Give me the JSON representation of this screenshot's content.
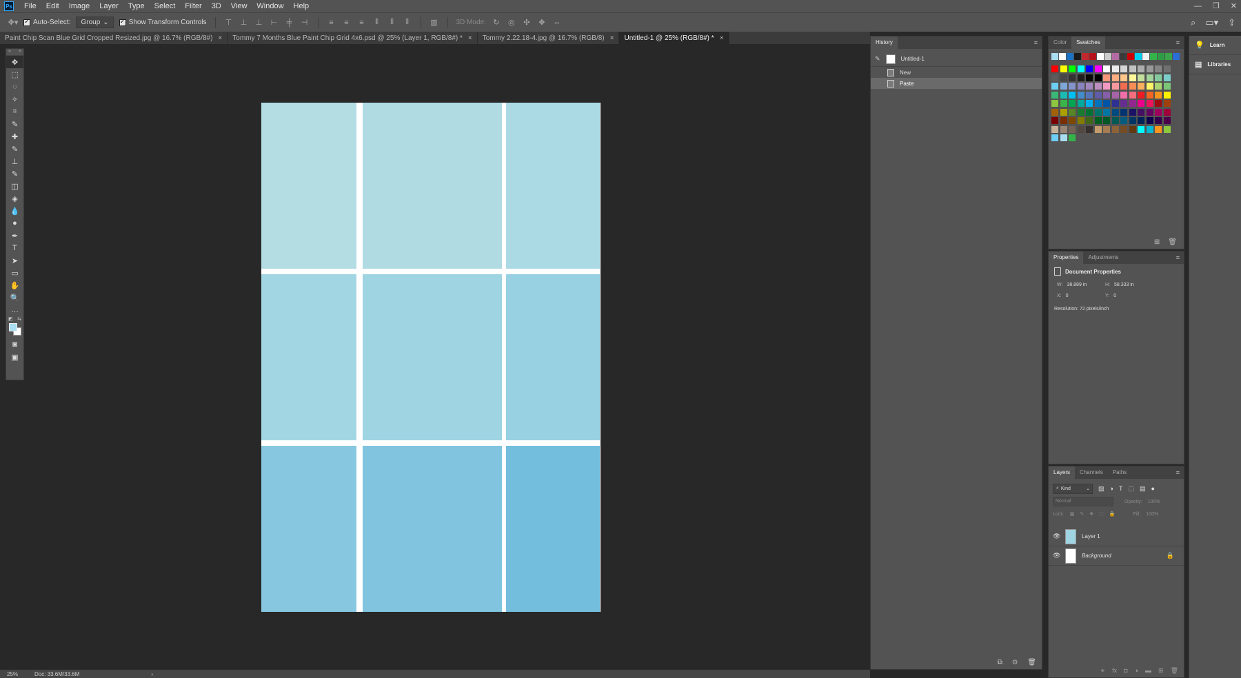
{
  "app": {
    "logo": "Ps",
    "menu": [
      "File",
      "Edit",
      "Image",
      "Layer",
      "Type",
      "Select",
      "Filter",
      "3D",
      "View",
      "Window",
      "Help"
    ],
    "window_controls": [
      "—",
      "❐",
      "✕"
    ]
  },
  "options_bar": {
    "auto_select_label": "Auto-Select:",
    "auto_select_value": "Group",
    "show_transform_label": "Show Transform Controls",
    "mode_3d_label": "3D Mode:"
  },
  "tabs": [
    {
      "label": "Paint Chip Scan Blue Grid Cropped Resized.jpg @ 16.7% (RGB/8#)",
      "active": false
    },
    {
      "label": "Tommy 7 Months Blue Paint Chip Grid 4x6.psd @ 25% (Layer 1, RGB/8#) *",
      "active": false
    },
    {
      "label": "Tommy 2.22.18-4.jpg @ 16.7% (RGB/8)",
      "active": false
    },
    {
      "label": "Untitled-1 @ 25% (RGB/8#) *",
      "active": true
    }
  ],
  "tools": [
    "move-icon",
    "marquee-icon",
    "lasso-icon",
    "magic-wand-icon",
    "crop-icon",
    "eyedropper-icon",
    "healing-brush-icon",
    "brush-icon",
    "clone-stamp-icon",
    "history-brush-icon",
    "eraser-icon",
    "paint-bucket-icon",
    "blur-icon",
    "dodge-icon",
    "pen-icon",
    "type-icon",
    "path-select-icon",
    "rectangle-icon",
    "hand-icon",
    "zoom-icon",
    "more-icon"
  ],
  "tool_glyphs": [
    "✥",
    "⬚",
    "◌",
    "✧",
    "⌗",
    "✎",
    "✚",
    "✎",
    "⊥",
    "✎",
    "◫",
    "◈",
    "💧",
    "●",
    "✒",
    "T",
    "➤",
    "▭",
    "✋",
    "🔍",
    "…"
  ],
  "colors": {
    "foreground": "#a9def0",
    "background": "#ffffff"
  },
  "document": {
    "chip_colors": [
      [
        "#b3dce3",
        "#b0dbe3",
        "#acdae4"
      ],
      [
        "#a3d6e3",
        "#9fd4e2",
        "#98d1e2"
      ],
      [
        "#87c8e0",
        "#80c4df",
        "#74bedd"
      ]
    ]
  },
  "status": {
    "zoom": "25%",
    "doc": "Doc: 33.6M/33.6M",
    "arrow": "›"
  },
  "history": {
    "tab": "History",
    "snapshot": "Untitled-1",
    "states": [
      {
        "label": "New",
        "selected": false
      },
      {
        "label": "Paste",
        "selected": true
      }
    ]
  },
  "swatches": {
    "tabs": [
      "Color",
      "Swatches"
    ],
    "recent": [
      "#a9def0",
      "#ffffff",
      "#1a73c6",
      "#1b1b1b",
      "#c1272d",
      "#b5121b",
      "#ffffff",
      "#cccccc",
      "#b46aa4",
      "#3b3b3b",
      "#cc0000",
      "#00d0f0",
      "#f2f2f2",
      "#34b34a",
      "#2e9e46",
      "#3aa54a",
      "#2b6fd6"
    ],
    "rows": [
      [
        "#ff0000",
        "#ffff00",
        "#00ff00",
        "#00ffff",
        "#0000ff",
        "#ff00ff",
        "#ffffff",
        "#ebebeb",
        "#d6d6d6",
        "#c2c2c2",
        "#adadad",
        "#999999",
        "#858585",
        "#707070"
      ],
      [
        "#5c5c5c",
        "#474747",
        "#333333",
        "#1f1f1f",
        "#0a0a0a",
        "#000000",
        "#f7977a",
        "#f9ad81",
        "#fdc68a",
        "#fff79a",
        "#c4df9b",
        "#a3d39c",
        "#82ca9d",
        "#7bcdc8"
      ],
      [
        "#6ecff6",
        "#7ea7d8",
        "#8493ca",
        "#8882be",
        "#a187be",
        "#bc8dbf",
        "#f49ac2",
        "#f6989d",
        "#f26c4f",
        "#f68e55",
        "#fbaf5c",
        "#fff467",
        "#acd372",
        "#7cc576"
      ],
      [
        "#3bb878",
        "#1abbb4",
        "#00bff3",
        "#438ccb",
        "#5574b9",
        "#605ca8",
        "#855fa8",
        "#a763a8",
        "#f06ea9",
        "#f26d7d",
        "#ed1c24",
        "#f26522",
        "#f7941d",
        "#fff200"
      ],
      [
        "#8dc63f",
        "#39b54a",
        "#00a651",
        "#00a99d",
        "#00aeef",
        "#0072bc",
        "#0054a6",
        "#2e3192",
        "#662d91",
        "#92278f",
        "#ec008c",
        "#ed145b",
        "#9e0b0f",
        "#a0410d"
      ],
      [
        "#a36209",
        "#aba000",
        "#598527",
        "#197b30",
        "#007236",
        "#00746b",
        "#0076a3",
        "#004a80",
        "#003471",
        "#1b1464",
        "#440e62",
        "#630460",
        "#9e005d",
        "#9e0039"
      ],
      [
        "#790000",
        "#7b2e00",
        "#7d4900",
        "#827b00",
        "#406618",
        "#005e20",
        "#005826",
        "#005952",
        "#005b7f",
        "#003663",
        "#002157",
        "#0d004c",
        "#32004b",
        "#4b0049"
      ],
      [
        "#c7b299",
        "#998675",
        "#736357",
        "#534741",
        "#37302d",
        "#c69c6d",
        "#a67c52",
        "#8c6239",
        "#754c24",
        "#603913",
        "#00ffff",
        "#00b8d4",
        "#f7941d",
        "#8dc63f"
      ],
      [
        "#6ecff6",
        "#a9def0",
        "#34b34a"
      ]
    ],
    "footer_icons": [
      "new-swatch-icon",
      "trash-icon"
    ]
  },
  "properties": {
    "tabs": [
      "Properties",
      "Adjustments"
    ],
    "title": "Document Properties",
    "w_label": "W:",
    "w_value": "38.889 in",
    "h_label": "H:",
    "h_value": "58.333 in",
    "x_label": "X:",
    "x_value": "0",
    "y_label": "Y:",
    "y_value": "0",
    "resolution": "Resolution: 72 pixels/inch"
  },
  "layers": {
    "tabs": [
      "Layers",
      "Channels",
      "Paths"
    ],
    "kind": "Kind",
    "blend_mode": "Normal",
    "opacity_label": "Opacity:",
    "opacity_value": "100%",
    "lock_label": "Lock:",
    "fill_label": "Fill:",
    "fill_value": "100%",
    "items": [
      {
        "name": "Layer 1",
        "thumb": "#9fd4e2",
        "locked": false
      },
      {
        "name": "Background",
        "thumb": "#ffffff",
        "locked": true
      }
    ]
  },
  "side_panels": [
    {
      "label": "Learn",
      "icon": "lightbulb-icon",
      "glyph": "💡"
    },
    {
      "label": "Libraries",
      "icon": "libraries-icon",
      "glyph": "▤"
    }
  ]
}
